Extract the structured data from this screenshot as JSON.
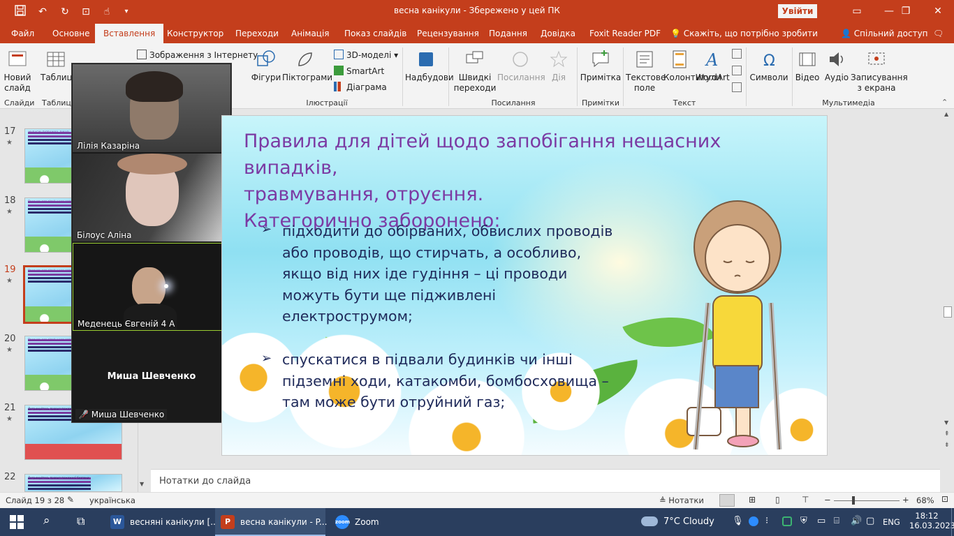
{
  "titlebar": {
    "title": "весна канікули  -  Збережено у цей ПК",
    "signin": "Увійти",
    "qa_icons": [
      "save-icon",
      "undo-icon",
      "redo-icon",
      "present-icon",
      "touch-icon",
      "customize-icon"
    ],
    "window_buttons": [
      "—",
      "❐",
      "✕"
    ]
  },
  "menu": {
    "tabs": [
      "Файл",
      "Основне",
      "Вставлення",
      "Конструктор",
      "Переходи",
      "Анімація",
      "Показ слайдів",
      "Рецензування",
      "Подання",
      "Довідка",
      "Foxit Reader PDF"
    ],
    "active_tab": "Вставлення",
    "tellme": "Скажіть, що потрібно зробити",
    "share": "Спільний доступ"
  },
  "ribbon": {
    "new_slide": "Новий слайд",
    "table": "Таблиця",
    "online_pictures": "Зображення з Інтернету",
    "shapes": "Фігури",
    "icons": "Піктограми",
    "models3d": "3D-моделі",
    "smartart": "SmartArt",
    "chart": "Діаграма",
    "addins": "Надбудови",
    "zoom": "Швидкі переходи",
    "link": "Посилання",
    "action": "Дія",
    "comment": "Примітка",
    "textbox": "Текстове поле",
    "header_footer": "Колонтитули",
    "wordart": "WordArt",
    "symbols": "Символи",
    "video": "Відео",
    "audio": "Аудіо",
    "screen_recording": "Записування з екрана",
    "groups": {
      "slides": "Слайди",
      "tables": "Таблиці",
      "illustrations": "Ілюстрації",
      "links": "Посилання",
      "comments": "Примітки",
      "text": "Текст",
      "media": "Мультимедіа"
    }
  },
  "thumbnails": [
    {
      "num": "17",
      "star": "★",
      "text": "ЖУВАГИ! ПІДВАЖКА, ВІКНО"
    },
    {
      "num": "18",
      "star": "★",
      "text": "Правила для дітей щодо запобігання"
    },
    {
      "num": "19",
      "star": "★",
      "text": "Правила для дітей щодо запобігання"
    },
    {
      "num": "20",
      "star": "★",
      "text": "Правила для дітей щодо запобігання"
    },
    {
      "num": "21",
      "star": "★",
      "text": "Дотримуйтесь правил пожежної безпеки:"
    },
    {
      "num": "22",
      "star": "",
      "text": "Дотримуйтесь правил пожежної безпеки:"
    }
  ],
  "zoom_panel": {
    "participants": [
      {
        "name": "Лілія Казаріна"
      },
      {
        "name": "Білоус Аліна"
      },
      {
        "name": "Меденець Євгеній 4 А"
      },
      {
        "name": "Миша Шевченко",
        "big_label": "Миша Шевченко"
      }
    ]
  },
  "slide": {
    "title": "Правила для дітей щодо запобігання нещасних випадків, травмування, отруєння. Категорично заборонено:",
    "title_lines": [
      "Правила для дітей щодо запобігання нещасних випадків,",
      "травмування, отруєння.",
      "Категорично заборонено:"
    ],
    "bullet_glyph": "➢",
    "bullets": [
      {
        "lines": [
          "підходити до обірваних, обвислих проводів",
          "або проводів, що стирчать, а особливо,",
          "якщо від них іде гудіння – ці проводи",
          "можуть бути ще підживлені",
          "електрострумом;"
        ]
      },
      {
        "lines": [
          "спускатися в підвали будинків чи інші",
          "підземні ходи, катакомби, бомбосховища –",
          "там може бути отруйний газ;"
        ]
      }
    ]
  },
  "notes": {
    "placeholder": "Нотатки до слайда"
  },
  "statusbar": {
    "slide_info": "Слайд 19 з 28",
    "language": "українська",
    "notes_btn": "Нотатки",
    "zoom": "68%"
  },
  "taskbar": {
    "apps": [
      {
        "label": "весняні канікули [...",
        "icon": "W",
        "color": "#2b579a"
      },
      {
        "label": "весна канікули - P...",
        "icon": "P",
        "color": "#c43e1c"
      },
      {
        "label": "Zoom",
        "icon": "zoom",
        "color": "#2d8cff"
      }
    ],
    "weather": "7°C  Cloudy",
    "lang": "ENG",
    "time": "18:12",
    "date": "16.03.2023"
  },
  "colors": {
    "accent": "#c43e1c",
    "slide_title": "#7b3aa3",
    "slide_text": "#1f2a5a",
    "taskbar": "#2a3e5e"
  }
}
